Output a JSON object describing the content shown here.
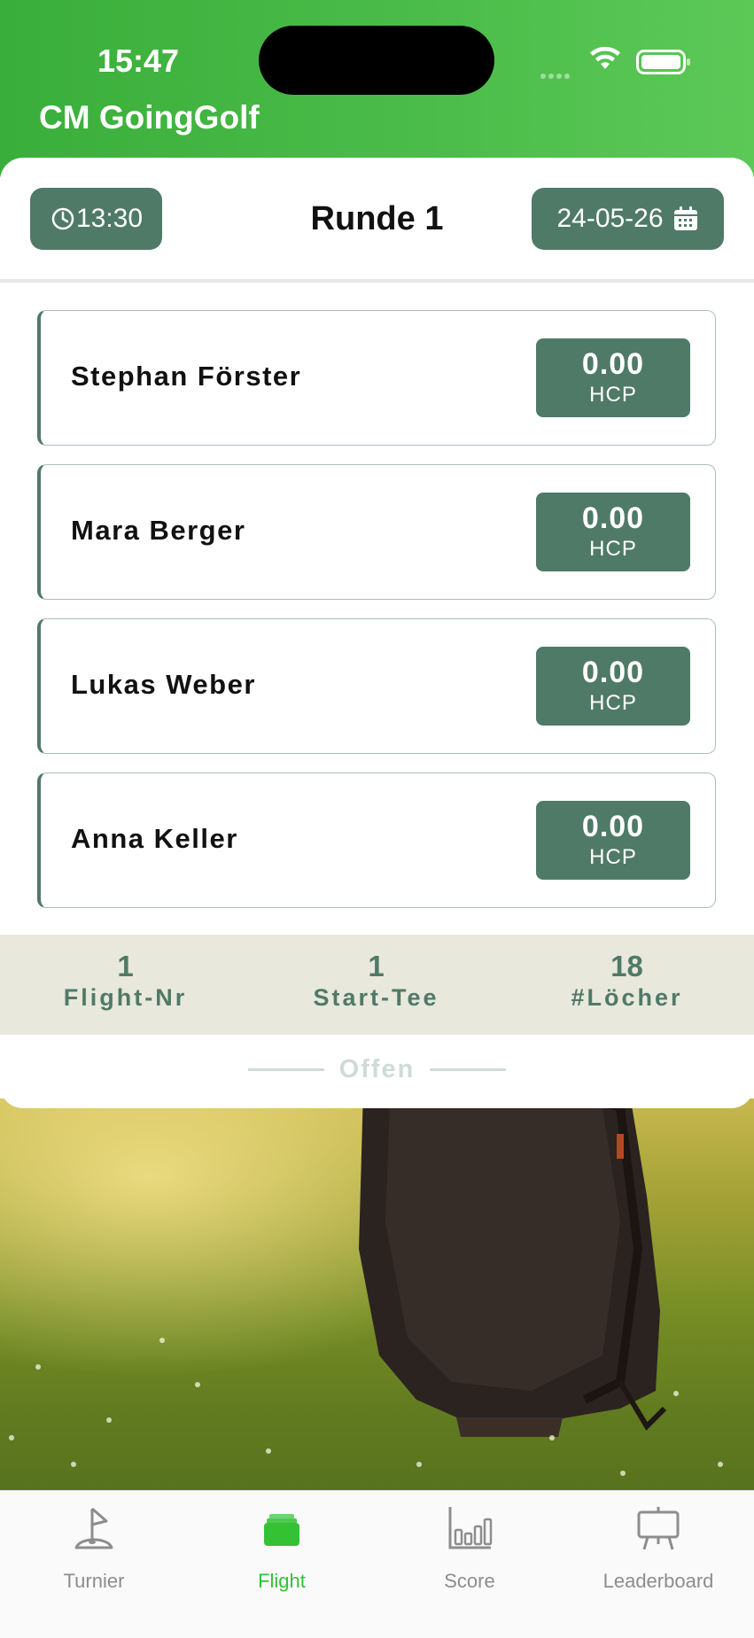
{
  "status_bar": {
    "time": "15:47"
  },
  "app": {
    "title": "CM GoingGolf"
  },
  "round": {
    "start_time": "13:30",
    "title": "Runde 1",
    "date": "24-05-26"
  },
  "players": [
    {
      "name": "Stephan Förster",
      "hcp": "0.00",
      "hcp_label": "HCP"
    },
    {
      "name": "Mara Berger",
      "hcp": "0.00",
      "hcp_label": "HCP"
    },
    {
      "name": "Lukas Weber",
      "hcp": "0.00",
      "hcp_label": "HCP"
    },
    {
      "name": "Anna Keller",
      "hcp": "0.00",
      "hcp_label": "HCP"
    }
  ],
  "stats": [
    {
      "value": "1",
      "label": "Flight-Nr"
    },
    {
      "value": "1",
      "label": "Start-Tee"
    },
    {
      "value": "18",
      "label": "#Löcher"
    }
  ],
  "status": {
    "label": "Offen"
  },
  "tabs": [
    {
      "label": "Turnier",
      "icon": "flag-icon",
      "active": false
    },
    {
      "label": "Flight",
      "icon": "stack-icon",
      "active": true
    },
    {
      "label": "Score",
      "icon": "bar-chart-icon",
      "active": false
    },
    {
      "label": "Leaderboard",
      "icon": "easel-board-icon",
      "active": false
    }
  ],
  "colors": {
    "header_green": "#3aae3a",
    "accent": "#4f7a67",
    "active_tab": "#34c234",
    "stats_bg": "#e9e8dd"
  }
}
